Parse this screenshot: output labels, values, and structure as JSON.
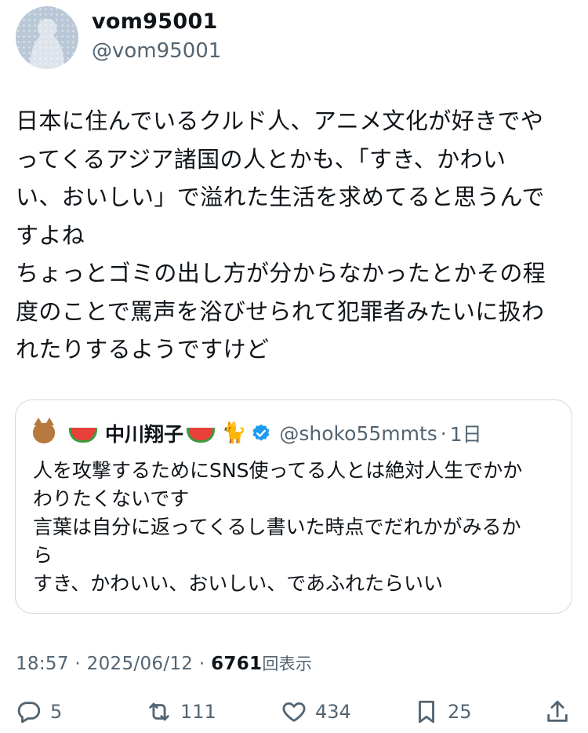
{
  "author": {
    "display_name": "vom95001",
    "handle": "@vom95001",
    "avatar_icon": "default-avatar"
  },
  "tweet": {
    "text": "日本に住んでいるクルド人、アニメ文化が好きでや\nってくるアジア諸国の人とかも、「すき、かわい\nい、おいしい」で溢れた生活を求めてると思うんで\nすよね\nちょっとゴミの出し方が分からなかったとかその程\n度のことで罵声を浴びせられて犯罪者みたいに扱わ\nれたりするようですけど"
  },
  "quote": {
    "display_name": "中川翔子",
    "handle": "@shoko55mmts",
    "separator": "·",
    "time": "1日",
    "name_emojis": [
      "cat-face-icon",
      "watermelon-icon",
      "watermelon-icon",
      "black-cat-icon"
    ],
    "verified_color": "#1d9bf0",
    "text": "人を攻撃するためにSNS使ってる人とは絶対人生でかか\nわりたくないです\n言葉は自分に返ってくるし書いた時点でだれかがみるか\nら\nすき、かわいい、おいしい、であふれたらいい"
  },
  "meta": {
    "time": "18:57",
    "sep1": "·",
    "date": "2025/06/12",
    "sep2": "·",
    "views_count": "6761",
    "views_label": "回表示"
  },
  "actions": {
    "replies": "5",
    "retweets": "111",
    "likes": "434",
    "bookmarks": "25"
  },
  "colors": {
    "text": "#0f1419",
    "secondary": "#536471",
    "border": "#cfd9de"
  }
}
